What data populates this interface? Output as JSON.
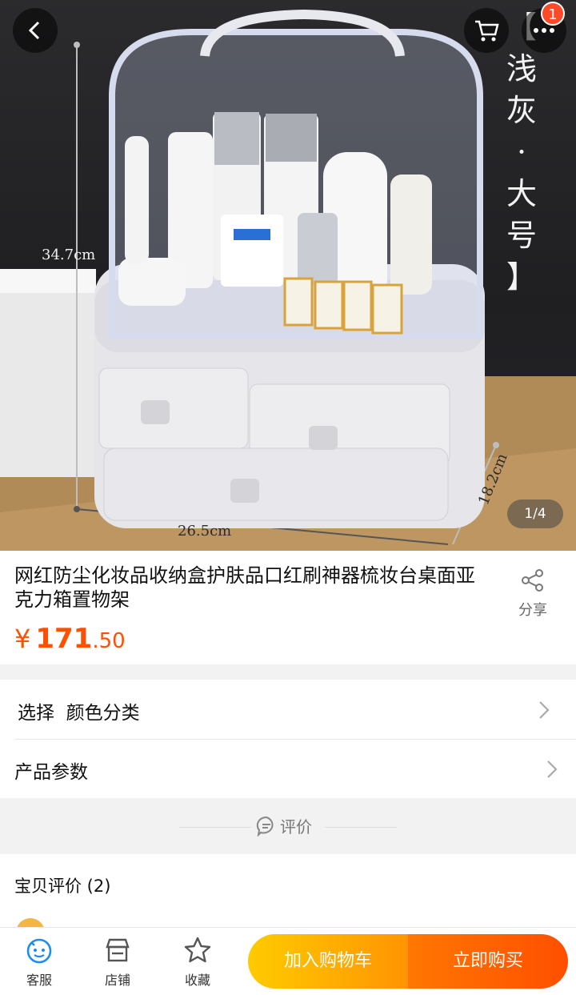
{
  "hero": {
    "color_tag": "【浅灰·大号】",
    "color_tag_chars": [
      "浅",
      "灰",
      "·",
      "大",
      "号"
    ],
    "dimension_height": "34.7cm",
    "dimension_width": "26.5cm",
    "dimension_depth": "18.2cm",
    "pager": "1/4",
    "cart_badge": "1",
    "back_icon": "chevron-left-icon",
    "cart_icon": "cart-icon",
    "more_icon": "more-dots-icon"
  },
  "product": {
    "title": "网红防尘化妆品收纳盒护肤品口红刷神器梳妆台桌面亚克力箱置物架",
    "price_symbol": "¥",
    "price_integer": "171",
    "price_decimal": ".50",
    "share_label": "分享",
    "price_color": "#ff5000"
  },
  "options": {
    "select_label": "选择  颜色分类",
    "params_label": "产品参数"
  },
  "reviews": {
    "divider_label": "评价",
    "header": "宝贝评价 (2)"
  },
  "bottom_bar": {
    "service_label": "客服",
    "shop_label": "店铺",
    "favorite_label": "收藏",
    "add_to_cart": "加入购物车",
    "buy_now": "立即购买",
    "cart_gradient": [
      "#ffcb00",
      "#ff9402"
    ],
    "buy_gradient": [
      "#ff7701",
      "#ff4f00"
    ]
  }
}
